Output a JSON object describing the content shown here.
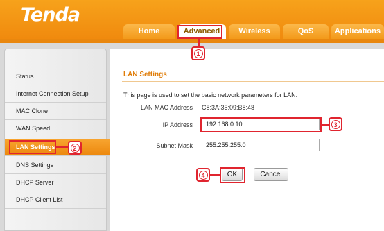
{
  "brand": {
    "logo_text": "Tenda"
  },
  "tabs": [
    "Home",
    "Advanced",
    "Wireless",
    "QoS",
    "Applications"
  ],
  "active_tab": "Advanced",
  "sidebar": {
    "items": [
      "Status",
      "Internet Connection Setup",
      "MAC Clone",
      "WAN Speed",
      "LAN Settings",
      "DNS Settings",
      "DHCP Server",
      "DHCP Client List"
    ],
    "active": "LAN Settings"
  },
  "main": {
    "title": "LAN Settings",
    "description": "This page is used to set the basic network parameters for LAN.",
    "mac_label": "LAN MAC Address",
    "mac_value": "C8:3A:35:09:B8:48",
    "ip_label": "IP Address",
    "ip_value": "192.168.0.10",
    "mask_label": "Subnet Mask",
    "mask_value": "255.255.255.0",
    "ok_label": "OK",
    "cancel_label": "Cancel"
  },
  "callouts": [
    "1",
    "2",
    "3",
    "4"
  ],
  "colors": {
    "brand_orange": "#f08a0e",
    "callout_red": "#e0252f",
    "title_orange": "#e07d09"
  }
}
